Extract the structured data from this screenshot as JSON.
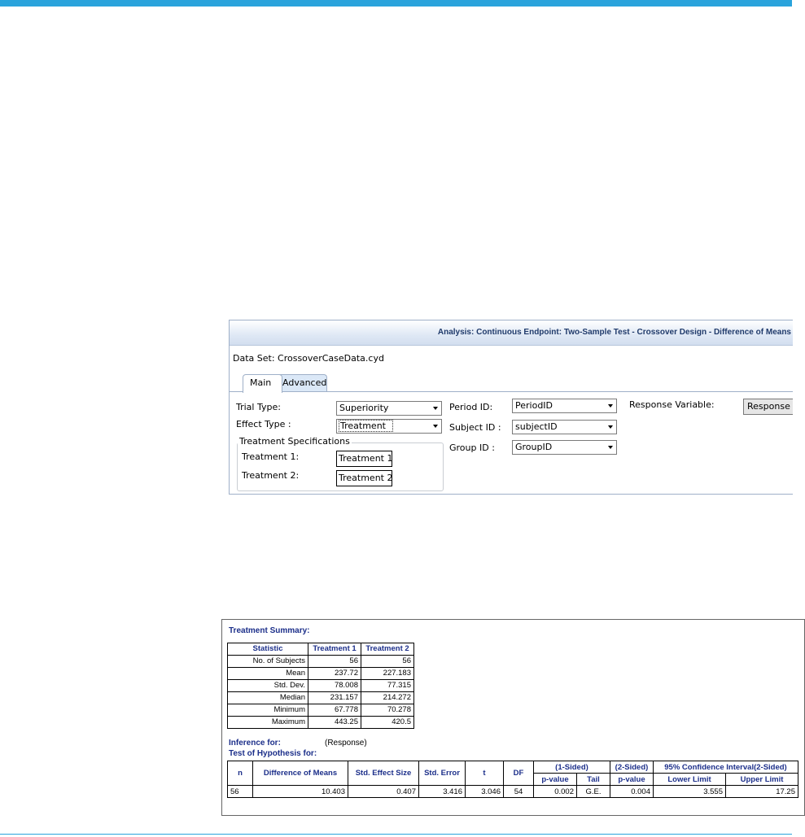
{
  "dialog": {
    "title": "Analysis: Continuous Endpoint: Two-Sample Test - Crossover Design - Difference of Means",
    "dataset_label": "Data Set: CrossoverCaseData.cyd",
    "tabs": [
      "Main",
      "Advanced"
    ],
    "trial_type": {
      "label": "Trial Type:",
      "value": "Superiority"
    },
    "effect_type": {
      "label": "Effect Type :",
      "value": "Treatment"
    },
    "treatment_specs": {
      "title": "Treatment Specifications",
      "t1_label": "Treatment 1:",
      "t1_value": "Treatment 1",
      "t2_label": "Treatment 2:",
      "t2_value": "Treatment 2"
    },
    "period_id": {
      "label": "Period ID:",
      "value": "PeriodID"
    },
    "subject_id": {
      "label": "Subject ID :",
      "value": "subjectID"
    },
    "group_id": {
      "label": "Group ID :",
      "value": "GroupID"
    },
    "response_variable": {
      "label": "Response Variable:",
      "value": "Response"
    }
  },
  "output": {
    "summary_heading": "Treatment Summary:",
    "summary_headers": [
      "Statistic",
      "Treatment 1",
      "Treatment 2"
    ],
    "summary_rows": [
      [
        "No. of Subjects",
        "56",
        "56"
      ],
      [
        "Mean",
        "237.72",
        "227.183"
      ],
      [
        "Std. Dev.",
        "78.008",
        "77.315"
      ],
      [
        "Median",
        "231.157",
        "214.272"
      ],
      [
        "Minimum",
        "67.778",
        "70.278"
      ],
      [
        "Maximum",
        "443.25",
        "420.5"
      ]
    ],
    "inference_label": "Inference for:",
    "inference_value": "(Response)",
    "hypothesis_label": "Test of Hypothesis for:",
    "inf_headers": {
      "n": "n",
      "diff": "Difference of Means",
      "effect": "Std. Effect Size",
      "se": "Std. Error",
      "t": "t",
      "df": "DF",
      "one_sided": "(1-Sided)",
      "two_sided": "(2-Sided)",
      "ci": "95% Confidence Interval(2-Sided)",
      "pvalue": "p-value",
      "tail": "Tail",
      "pvalue2": "p-value",
      "lower": "Lower Limit",
      "upper": "Upper Limit"
    },
    "inf_row": {
      "n": "56",
      "diff": "10.403",
      "effect": "0.407",
      "se": "3.416",
      "t": "3.046",
      "df": "54",
      "p1": "0.002",
      "tail": "G.E.",
      "p2": "0.004",
      "lower": "3.555",
      "upper": "17.25"
    }
  }
}
